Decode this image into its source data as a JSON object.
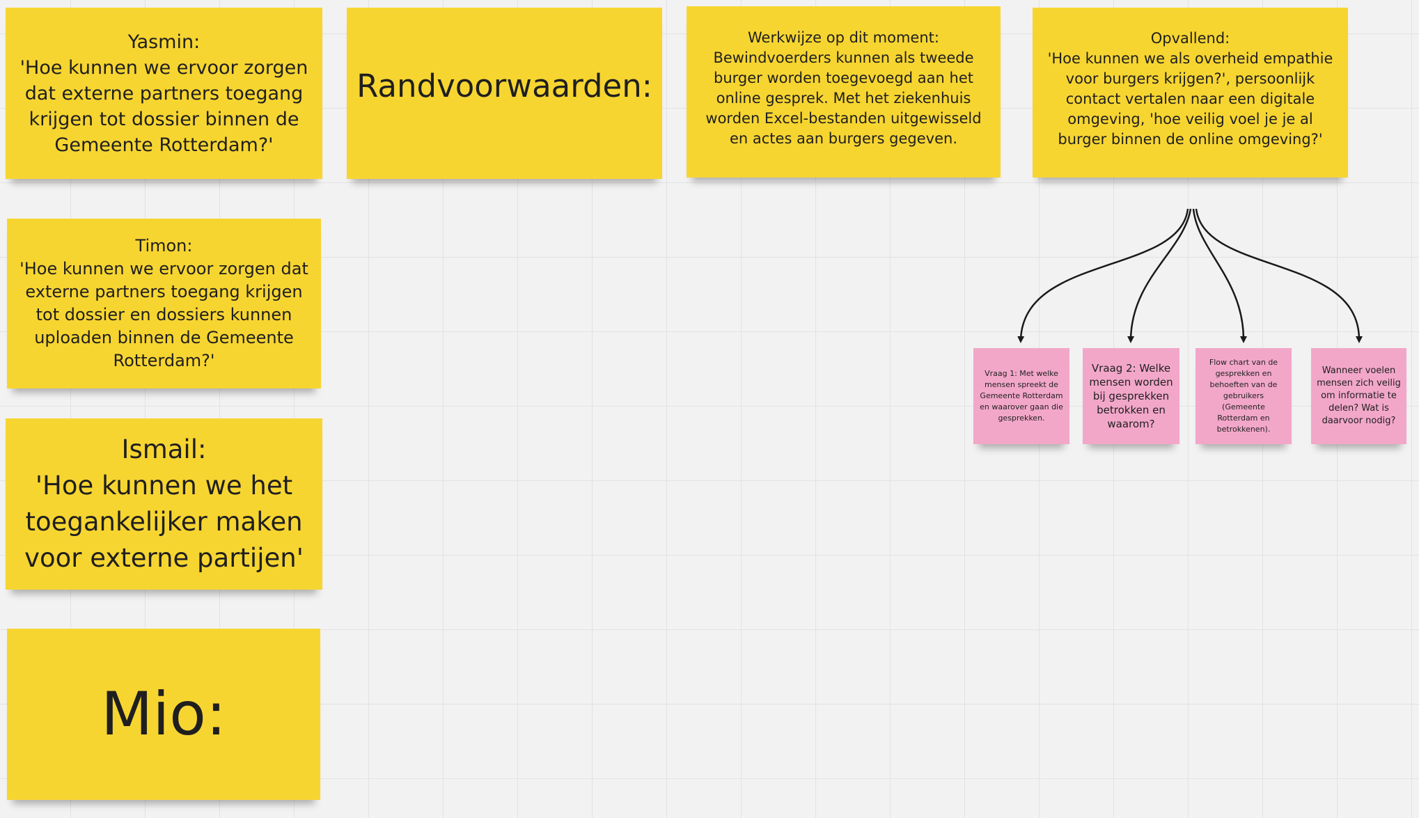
{
  "notes_left": {
    "yasmin": "Yasmin:\n'Hoe kunnen we ervoor zorgen dat externe partners toegang krijgen tot dossier binnen de Gemeente Rotterdam?'",
    "timon": "Timon:\n'Hoe kunnen we ervoor zorgen dat externe partners toegang krijgen tot dossier en dossiers kunnen uploaden binnen de Gemeente Rotterdam?'",
    "ismail": "Ismail:\n'Hoe kunnen we het toegankelijker maken voor externe partijen'",
    "mio": "Mio:"
  },
  "notes_top": {
    "randvoorwaarden": "Randvoorwaarden:",
    "werkwijze": "Werkwijze op dit moment:\nBewindvoerders kunnen als tweede burger worden toegevoegd aan het online gesprek. Met het ziekenhuis worden Excel-bestanden uitgewisseld en actes aan burgers gegeven.",
    "opvallend": "Opvallend:\n'Hoe kunnen we als overheid empathie voor burgers krijgen?', persoonlijk contact vertalen naar een digitale omgeving, 'hoe veilig voel je je al burger binnen de online omgeving?'"
  },
  "notes_pink": {
    "vraag1": "Vraag 1: Met welke mensen spreekt de Gemeente Rotterdam en waarover gaan die gesprekken.",
    "vraag2": "Vraag 2: Welke mensen worden bij gesprekken betrokken en waarom?",
    "flowchart": "Flow chart van de gesprekken en behoeften van de gebruikers (Gemeente Rotterdam en betrokkenen).",
    "veilig": "Wanneer voelen mensen zich veilig om informatie te delen? Wat is daarvoor nodig?"
  },
  "colors": {
    "sticky_yellow": "#f7d531",
    "sticky_pink": "#f2a7c9",
    "canvas": "#f2f2f2",
    "connector": "#1a1a1a"
  }
}
